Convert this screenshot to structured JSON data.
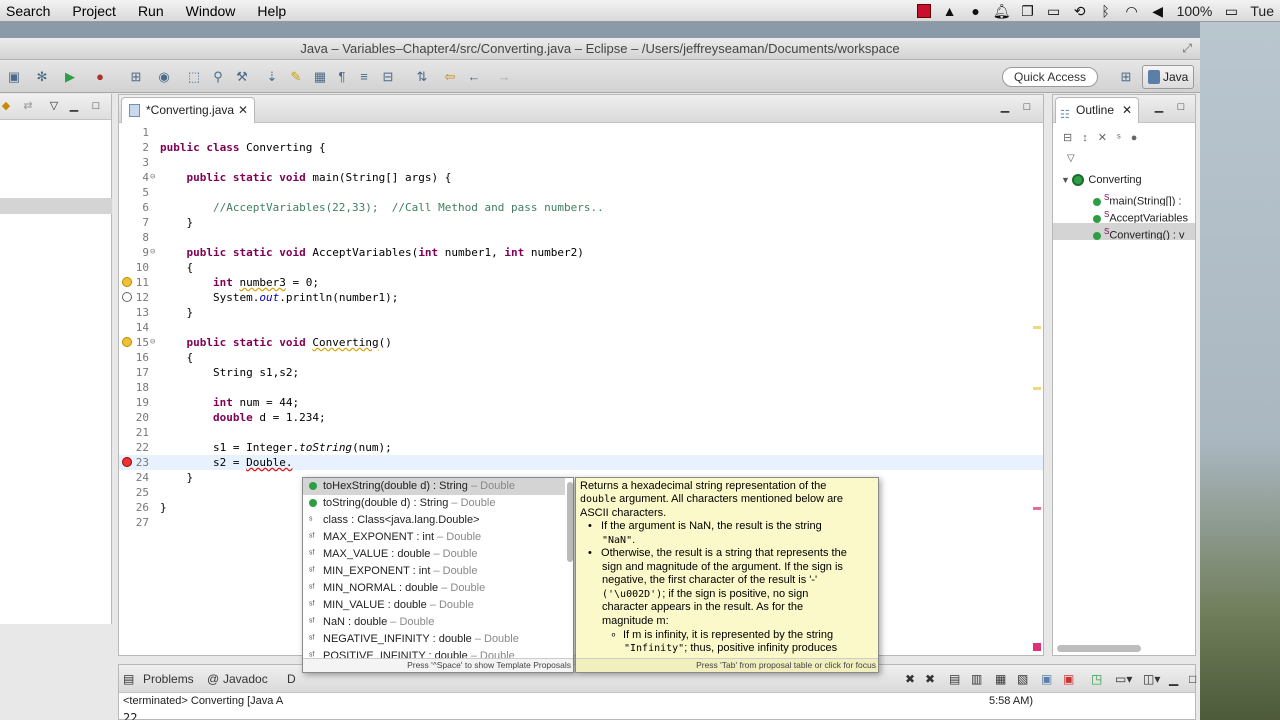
{
  "menubar": {
    "items": [
      "Search",
      "Project",
      "Run",
      "Window",
      "Help"
    ],
    "battery": "100%",
    "day": "Tue"
  },
  "window": {
    "title": "Java – Variables–Chapter4/src/Converting.java – Eclipse – /Users/jeffreyseaman/Documents/workspace"
  },
  "toolbar": {
    "quick_access": "Quick Access",
    "perspective": "Java"
  },
  "editor": {
    "tab_label": "*Converting.java",
    "lines": [
      {
        "n": "1",
        "text": ""
      },
      {
        "n": "2",
        "text": "public class Converting {"
      },
      {
        "n": "3",
        "text": ""
      },
      {
        "n": "4",
        "text": "    public static void main(String[] args) {"
      },
      {
        "n": "5",
        "text": ""
      },
      {
        "n": "6",
        "text": "        //AcceptVariables(22,33);  //Call Method and pass numbers.."
      },
      {
        "n": "7",
        "text": "    }"
      },
      {
        "n": "8",
        "text": ""
      },
      {
        "n": "9",
        "text": "    public static void AcceptVariables(int number1, int number2)"
      },
      {
        "n": "10",
        "text": "    {"
      },
      {
        "n": "11",
        "text": "        int number3 = 0;"
      },
      {
        "n": "12",
        "text": "        System.out.println(number1);"
      },
      {
        "n": "13",
        "text": "    }"
      },
      {
        "n": "14",
        "text": ""
      },
      {
        "n": "15",
        "text": "    public static void Converting()"
      },
      {
        "n": "16",
        "text": "    {"
      },
      {
        "n": "17",
        "text": "        String s1,s2;"
      },
      {
        "n": "18",
        "text": ""
      },
      {
        "n": "19",
        "text": "        int num = 44;"
      },
      {
        "n": "20",
        "text": "        double d = 1.234;"
      },
      {
        "n": "21",
        "text": ""
      },
      {
        "n": "22",
        "text": "        s1 = Integer.toString(num);"
      },
      {
        "n": "23",
        "text": "        s2 = Double."
      },
      {
        "n": "24",
        "text": "    }"
      },
      {
        "n": "25",
        "text": ""
      },
      {
        "n": "26",
        "text": "}"
      },
      {
        "n": "27",
        "text": ""
      }
    ]
  },
  "outline": {
    "tab_label": "Outline",
    "items": [
      "Converting",
      "main(String[]) :",
      "AcceptVariables",
      "Converting() : v"
    ]
  },
  "content_assist": {
    "proposals": [
      {
        "name": "toHexString(double d) : String",
        "owner": " – Double",
        "kind": "method"
      },
      {
        "name": "toString(double d) : String",
        "owner": " – Double",
        "kind": "method"
      },
      {
        "name": "class : Class<java.lang.Double>",
        "owner": "",
        "kind": "field"
      },
      {
        "name": "MAX_EXPONENT : int",
        "owner": " – Double",
        "kind": "field"
      },
      {
        "name": "MAX_VALUE : double",
        "owner": " – Double",
        "kind": "field"
      },
      {
        "name": "MIN_EXPONENT : int",
        "owner": " – Double",
        "kind": "field"
      },
      {
        "name": "MIN_NORMAL : double",
        "owner": " – Double",
        "kind": "field"
      },
      {
        "name": "MIN_VALUE : double",
        "owner": " – Double",
        "kind": "field"
      },
      {
        "name": "NaN : double",
        "owner": " – Double",
        "kind": "field"
      },
      {
        "name": "NEGATIVE_INFINITY : double",
        "owner": " – Double",
        "kind": "field"
      },
      {
        "name": "POSITIVE_INFINITY : double",
        "owner": " – Double",
        "kind": "field"
      }
    ],
    "footer": "Press '^Space' to show Template Proposals"
  },
  "javadoc": {
    "p1a": "Returns a hexadecimal string representation of the",
    "p1b_code": "double",
    "p1b_text": " argument. All characters mentioned below are",
    "p1c": "ASCII characters.",
    "b1a": "If the argument is NaN, the result is the string",
    "b1b_code": "\"NaN\"",
    "b1b_end": ".",
    "b2a": "Otherwise, the result is a string that represents the",
    "b2b": "sign and magnitude of the argument. If the sign is",
    "b2c": "negative, the first character of the result is '-'",
    "b2d_code": "('\\u002D')",
    "b2d_text": "; if the sign is positive, no sign",
    "b2e": "character appears in the result. As for the",
    "b2f": "magnitude m:",
    "b3a": "If m is infinity, it is represented by the string",
    "b3b_code": "\"Infinity\"",
    "b3b_text": "; thus, positive infinity produces",
    "footer": "Press 'Tab' from proposal table or click for focus"
  },
  "bottom": {
    "tabs": [
      "Problems",
      "Javadoc",
      "D"
    ],
    "status": "<terminated> Converting [Java A",
    "time_suffix": "5:58 AM)",
    "output": "22"
  }
}
